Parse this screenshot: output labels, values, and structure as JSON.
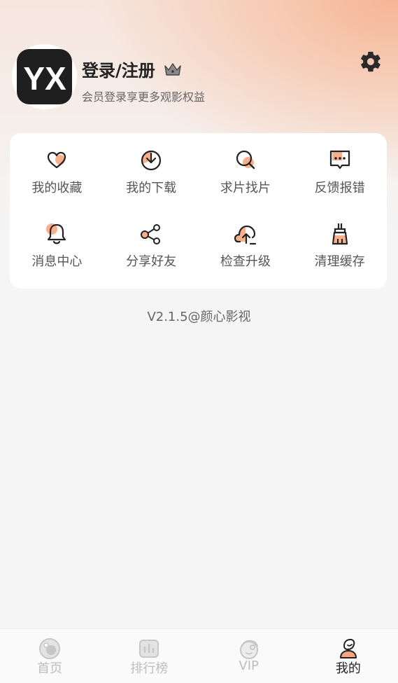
{
  "profile": {
    "avatar_text": "YX",
    "title": "登录/注册",
    "subtitle": "会员登录享更多观影权益"
  },
  "menu": [
    {
      "label": "我的收藏",
      "icon": "heart-icon"
    },
    {
      "label": "我的下载",
      "icon": "download-clock-icon"
    },
    {
      "label": "求片找片",
      "icon": "search-icon"
    },
    {
      "label": "反馈报错",
      "icon": "feedback-icon"
    },
    {
      "label": "消息中心",
      "icon": "bell-icon"
    },
    {
      "label": "分享好友",
      "icon": "share-icon"
    },
    {
      "label": "检查升级",
      "icon": "cloud-upload-icon"
    },
    {
      "label": "清理缓存",
      "icon": "broom-icon"
    }
  ],
  "version": "V2.1.5@颜心影视",
  "tabs": [
    {
      "label": "首页",
      "icon": "home-icon",
      "active": false
    },
    {
      "label": "排行榜",
      "icon": "ranking-icon",
      "active": false
    },
    {
      "label": "VIP",
      "icon": "vip-icon",
      "active": false
    },
    {
      "label": "我的",
      "icon": "profile-icon",
      "active": true
    }
  ],
  "colors": {
    "accent": "#f6a57f",
    "text_dark": "#222222",
    "text_gray": "#666666",
    "tab_inactive": "#bdbdbd"
  }
}
